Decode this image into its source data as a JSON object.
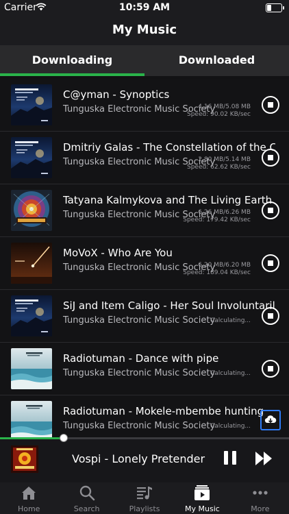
{
  "status": {
    "carrier": "Carrier",
    "time": "10:59 AM"
  },
  "header": {
    "title": "My Music"
  },
  "tabs": [
    {
      "label": "Downloading",
      "active": true
    },
    {
      "label": "Downloaded",
      "active": false
    }
  ],
  "colors": {
    "accent": "#2ab34a",
    "cloud_button": "#2f7bf6"
  },
  "tracks": [
    {
      "title": "C@yman - Synoptics",
      "artist": "Tunguska Electronic Music Society",
      "size": "4.16 MB/5.08 MB",
      "speed": "Speed: 90.02 KB/sec",
      "action": "stop",
      "art": "beshtau-art"
    },
    {
      "title": "Dmitriy Galas - The Constellation of the Canis",
      "artist": "Tunguska Electronic Music Society",
      "size": "2.80 MB/5.14 MB",
      "speed": "Speed: 62.62 KB/sec",
      "action": "stop",
      "art": "beshtau-art"
    },
    {
      "title": "Tatyana Kalmykova and The Living Earth -",
      "artist": "Tunguska Electronic Music Society",
      "size": "6.26 MB/6.26 MB",
      "speed": "Speed: 179.42 KB/sec",
      "action": "stop",
      "art": "mandala-art"
    },
    {
      "title": "MoVoX - Who Are You",
      "artist": "Tunguska Electronic Music Society",
      "size": "6.20 MB/6.20 MB",
      "speed": "Speed: 189.04 KB/sec",
      "action": "stop",
      "art": "meteor-art"
    },
    {
      "title": "SiJ and Item Caligo - Her Soul Involuntarily",
      "artist": "Tunguska Electronic Music Society",
      "status": "Calculating...",
      "action": "stop",
      "art": "beshtau-art"
    },
    {
      "title": "Radiotuman - Dance with pipe",
      "artist": "Tunguska Electronic Music Society",
      "status": "Calculating...",
      "action": "stop",
      "art": "sea-art"
    },
    {
      "title": "Radiotuman - Mokele-mbembe hunting",
      "artist": "Tunguska Electronic Music Society",
      "status": "Calculating...",
      "action": "download",
      "art": "sea-art"
    }
  ],
  "player": {
    "title": "Vospi - Lonely Pretender",
    "progress": 0.22
  },
  "tabbar": [
    {
      "label": "Home",
      "icon": "home-icon",
      "active": false
    },
    {
      "label": "Search",
      "icon": "search-icon",
      "active": false
    },
    {
      "label": "Playlists",
      "icon": "playlists-icon",
      "active": false
    },
    {
      "label": "My Music",
      "icon": "my-music-icon",
      "active": true
    },
    {
      "label": "More",
      "icon": "more-icon",
      "active": false
    }
  ]
}
